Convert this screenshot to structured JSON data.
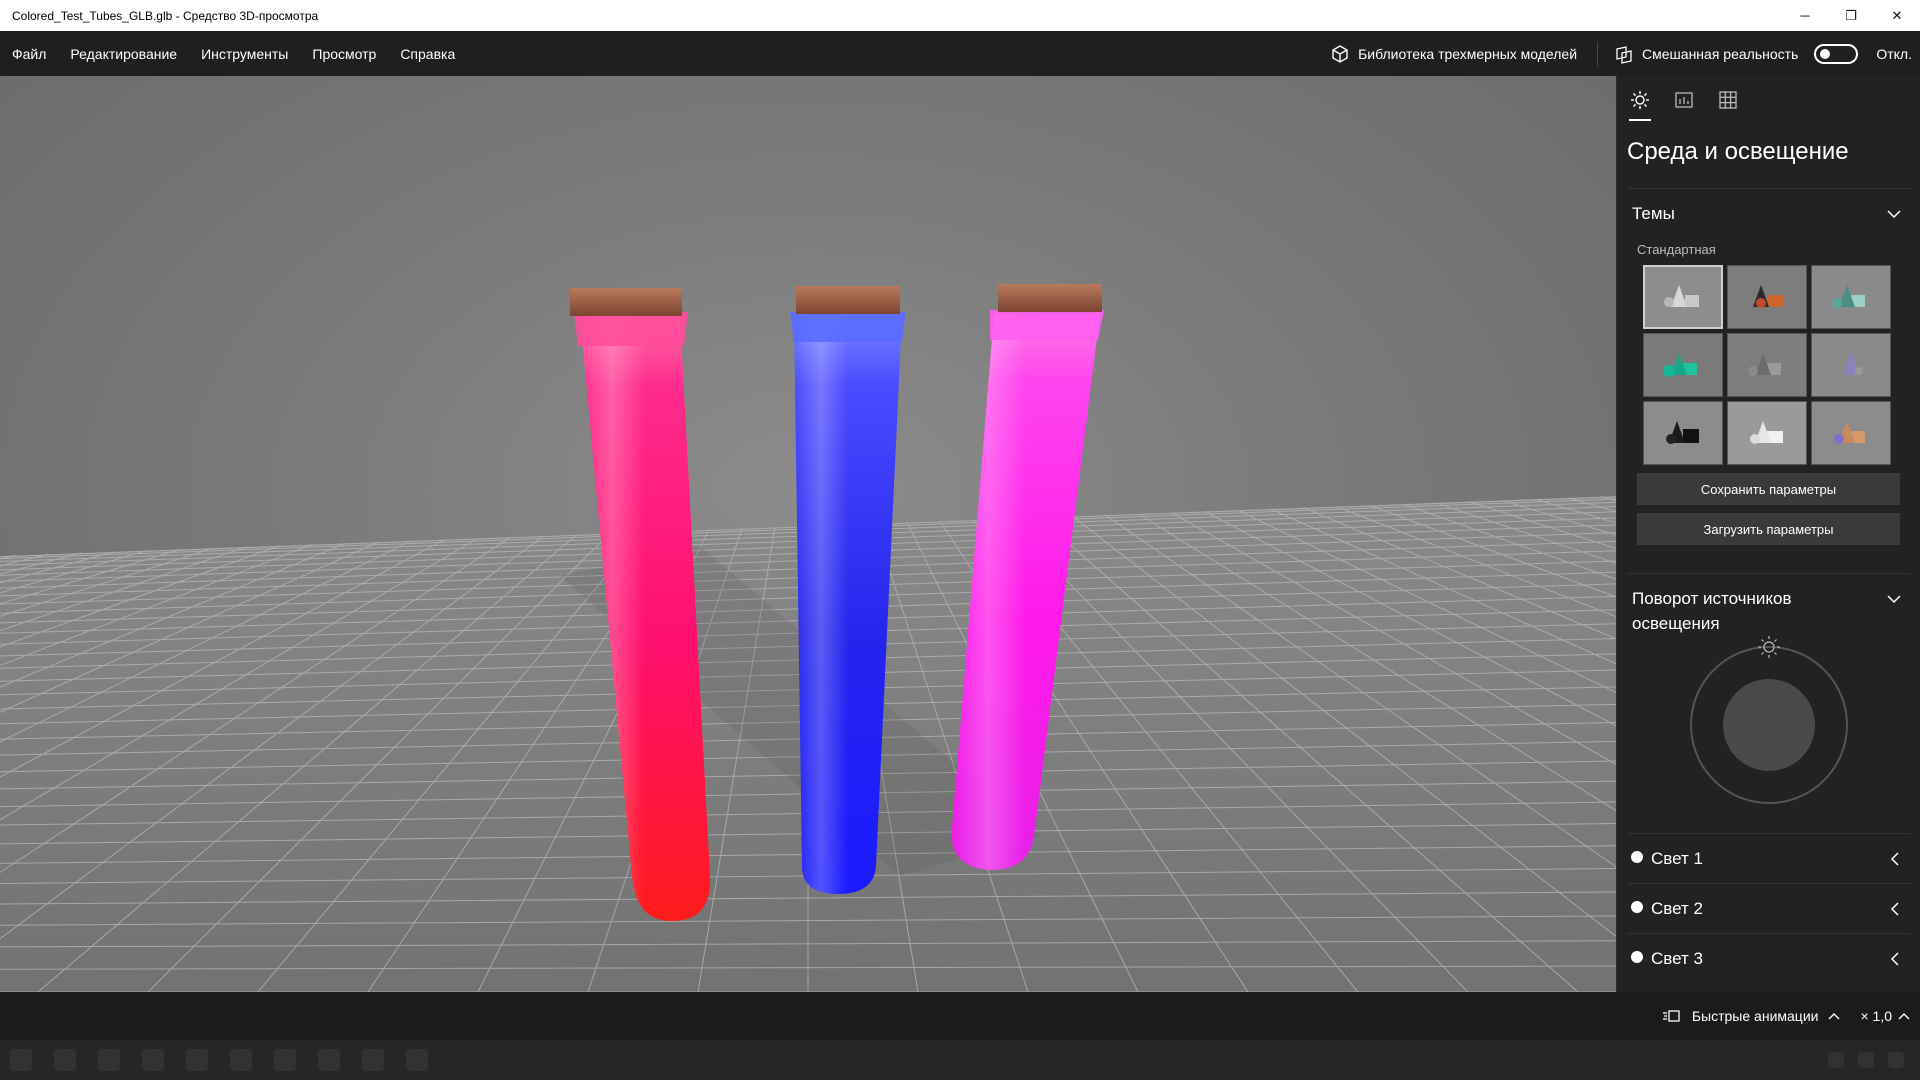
{
  "window": {
    "title": "Colored_Test_Tubes_GLB.glb - Средство 3D-просмотра",
    "minimize": "─",
    "restore": "❐",
    "close": "✕"
  },
  "menu": {
    "items": [
      "Файл",
      "Редактирование",
      "Инструменты",
      "Просмотр",
      "Справка"
    ],
    "library_label": "Библиотека трехмерных моделей",
    "mixed_reality_label": "Смешанная реальность",
    "mixed_reality_state": "Откл."
  },
  "scene": {
    "tubes": [
      {
        "top_color": "#ff2a8c",
        "mid_color": "#ff0f6e",
        "bottom_color": "#ff1a1a"
      },
      {
        "top_color": "#4a4aff",
        "mid_color": "#2525ee",
        "bottom_color": "#1a1aff"
      },
      {
        "top_color": "#ff44ee",
        "mid_color": "#ff1aea",
        "bottom_color": "#e81ee8"
      }
    ],
    "cork_color": "#9a5a3e"
  },
  "panel": {
    "tabs": [
      "sun-icon",
      "stats-icon",
      "grid-icon"
    ],
    "title": "Среда и освещение",
    "themes": {
      "header": "Темы",
      "group_label": "Стандартная",
      "count": 9,
      "selected": 0
    },
    "save_button": "Сохранить параметры",
    "load_button": "Загрузить параметры",
    "rotation": {
      "header": "Поворот источников освещения"
    },
    "lights": [
      "Свет 1",
      "Свет 2",
      "Свет 3"
    ]
  },
  "bottom": {
    "animations_label": "Быстрые анимации",
    "speed_label": "× 1,0"
  }
}
